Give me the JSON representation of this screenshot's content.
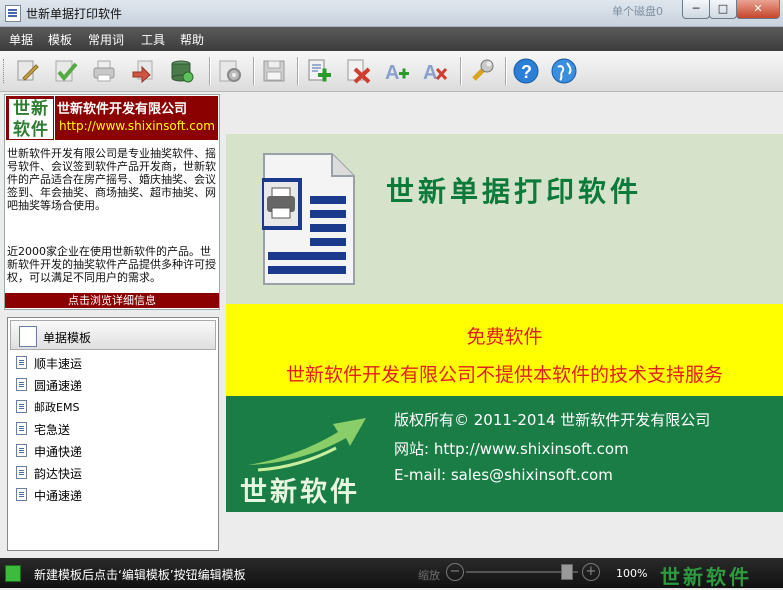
{
  "window": {
    "title": "世新单据打印软件",
    "blurred_text": "单个磁盘0",
    "buttons": {
      "minimize": "─",
      "maximize": "□",
      "close": "✕"
    }
  },
  "menu": [
    "单据",
    "模板",
    "常用词",
    "工具",
    "帮助"
  ],
  "toolbar_icons": [
    "edit-icon",
    "check-icon",
    "print-icon",
    "import-icon",
    "database-icon",
    "settings-icon",
    "save-icon",
    "add-icon",
    "delete-icon",
    "text-add-icon",
    "text-remove-icon",
    "wrench-icon",
    "help-icon",
    "web-icon"
  ],
  "company": {
    "logo_line1": "世新",
    "logo_line2": "软件",
    "name": "世新软件开发有限公司",
    "url": "http://www.shixinsoft.com",
    "description": "世新软件开发有限公司是专业抽奖软件、摇号软件、会议签到软件产品开发商，世新软件的产品适合在房产摇号、婚庆抽奖、会议签到、年会抽奖、商场抽奖、超市抽奖、网吧抽奖等场合使用。",
    "description2": "近2000家企业在使用世新软件的产品。世新软件开发的抽奖软件产品提供多种许可授权，可以满足不同用户的需求。",
    "detail_link": "点击浏览详细信息"
  },
  "templates": {
    "header": "单据模板",
    "items": [
      "顺丰速运",
      "圆通速递",
      "邮政EMS",
      "宅急送",
      "申通快递",
      "韵达快运",
      "中通速递"
    ]
  },
  "banner": {
    "product_name": "世新单据打印软件",
    "free": "免费软件",
    "no_support": "世新软件开发有限公司不提供本软件的技术支持服务",
    "logo_text": "世新软件",
    "copyright": "版权所有© 2011-2014  世新软件开发有限公司",
    "website": "网站: http://www.shixinsoft.com",
    "email": "E-mail: sales@shixinsoft.com"
  },
  "status": {
    "text": "新建模板后点击‘编辑模板’按钮编辑模板",
    "zoom_label": "缩放",
    "zoom_minus": "−",
    "zoom_plus": "+",
    "zoom_value": "100%",
    "zoom_fraction": 0.9,
    "logo": "世新软件"
  },
  "colors": {
    "brand_red": "#8b0000",
    "brand_green": "#1a7d45",
    "banner_yellow": "#ffff00",
    "warning_red": "#e02020"
  }
}
